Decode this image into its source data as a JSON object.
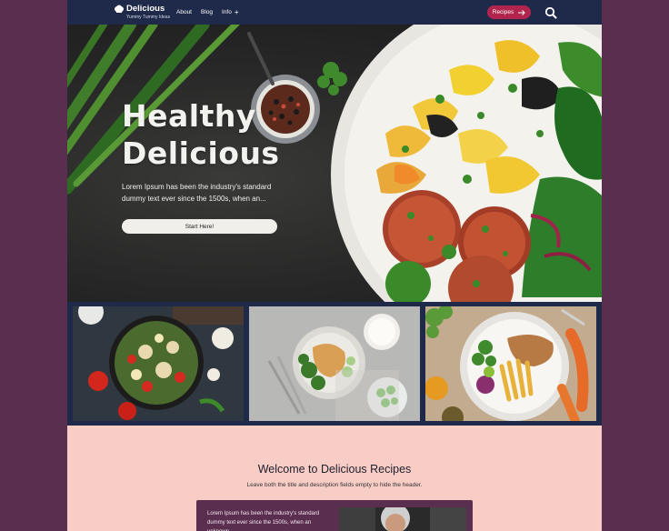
{
  "header": {
    "logo_title": "Delicious",
    "logo_tagline": "Yummy Tummy Ideas",
    "nav": [
      {
        "label": "About"
      },
      {
        "label": "Blog"
      },
      {
        "label": "Info",
        "has_submenu": true
      }
    ],
    "cta_label": "Recipes",
    "search_icon": "search-icon"
  },
  "hero": {
    "title_line1": "Healthy",
    "title_line2": "Delicious",
    "description": "Lorem Ipsum has been the industry's standard dummy text ever since the 1500s, when an...",
    "button_label": "Start Here!"
  },
  "welcome": {
    "title": "Welcome to Delicious Recipes",
    "subtitle": "Leave both the title and description fields empty to hide the header.",
    "card_text": "Lorem Ipsum has been the industry's standard dummy text ever since the 1500s, when an unknown"
  },
  "colors": {
    "page_background": "#5a2e4e",
    "header_background": "#1f2a4a",
    "cta_background": "#b1254d",
    "welcome_background": "#f8cdc5",
    "card_background": "#5a2e4e"
  }
}
